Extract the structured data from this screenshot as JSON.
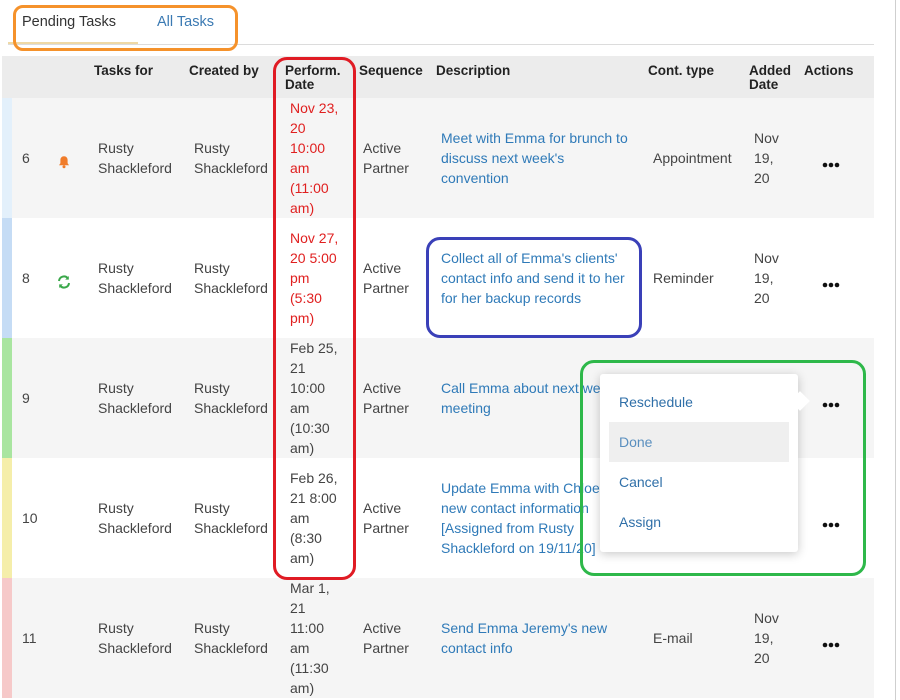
{
  "tabs": {
    "pending": "Pending Tasks",
    "all": "All Tasks"
  },
  "headers": {
    "tasks_for": "Tasks for",
    "created_by": "Created by",
    "perform_date_1": "Perform.",
    "perform_date_2": "Date",
    "sequence": "Sequence",
    "description": "Description",
    "cont_type": "Cont. type",
    "added_date_1": "Added",
    "added_date_2": "Date",
    "actions": "Actions"
  },
  "rows": [
    {
      "id": "6",
      "icon": "bell-icon",
      "tasks_for": [
        "Rusty",
        "Shackleford"
      ],
      "created_by": [
        "Rusty",
        "Shackleford"
      ],
      "perform_date": [
        "Nov 23,",
        "20",
        "10:00",
        "am",
        "(11:00",
        "am)"
      ],
      "overdue": true,
      "sequence": [
        "Active",
        "Partner"
      ],
      "description": [
        "Meet with Emma for brunch to",
        "discuss next week's",
        "convention"
      ],
      "cont_type": "Appointment",
      "added_date": [
        "Nov",
        "19,",
        "20"
      ]
    },
    {
      "id": "8",
      "icon": "recurring-icon",
      "tasks_for": [
        "Rusty",
        "Shackleford"
      ],
      "created_by": [
        "Rusty",
        "Shackleford"
      ],
      "perform_date": [
        "Nov 27,",
        "20 5:00",
        "pm",
        "(5:30",
        "pm)"
      ],
      "overdue": true,
      "sequence": [
        "Active",
        "Partner"
      ],
      "description": [
        "Collect all of Emma's clients'",
        "contact info and send it to her",
        "for her backup records"
      ],
      "cont_type": "Reminder",
      "added_date": [
        "Nov",
        "19,",
        "20"
      ]
    },
    {
      "id": "9",
      "icon": "",
      "tasks_for": [
        "Rusty",
        "Shackleford"
      ],
      "created_by": [
        "Rusty",
        "Shackleford"
      ],
      "perform_date": [
        "Feb 25,",
        "21",
        "10:00",
        "am",
        "(10:30",
        "am)"
      ],
      "overdue": false,
      "sequence": [
        "Active",
        "Partner"
      ],
      "description": [
        "Call Emma about next we",
        "meeting"
      ],
      "cont_type": "",
      "added_date": []
    },
    {
      "id": "10",
      "icon": "",
      "tasks_for": [
        "Rusty",
        "Shackleford"
      ],
      "created_by": [
        "Rusty",
        "Shackleford"
      ],
      "perform_date": [
        "Feb 26,",
        "21 8:00",
        "am",
        "(8:30",
        "am)"
      ],
      "overdue": false,
      "sequence": [
        "Active",
        "Partner"
      ],
      "description": [
        "Update Emma with Chloe",
        "new contact information",
        "[Assigned from Rusty",
        "Shackleford on 19/11/20]"
      ],
      "cont_type": "",
      "added_date": []
    },
    {
      "id": "11",
      "icon": "",
      "tasks_for": [
        "Rusty",
        "Shackleford"
      ],
      "created_by": [
        "Rusty",
        "Shackleford"
      ],
      "perform_date": [
        "Mar 1,",
        "21",
        "11:00",
        "am",
        "(11:30",
        "am)"
      ],
      "overdue": false,
      "sequence": [
        "Active",
        "Partner"
      ],
      "description": [
        "Send Emma Jeremy's new",
        "contact info"
      ],
      "cont_type": "E-mail",
      "added_date": [
        "Nov",
        "19,",
        "20"
      ]
    }
  ],
  "menu": {
    "items": [
      "Reschedule",
      "Done",
      "Cancel",
      "Assign"
    ],
    "highlighted": "Done"
  },
  "colors": {
    "stripes": [
      "#e3f0fb",
      "#c5dcf5",
      "#a9e5a0",
      "#f5eeaa",
      "#f6c9c9"
    ],
    "overdue": "#e02020",
    "link": "#2f7ab8",
    "bell": "#f07c2a",
    "recurring": "#3aa84a",
    "annotation_orange": "#f5922b",
    "annotation_red": "#e01b24",
    "annotation_blue": "#3a40b8",
    "annotation_green": "#2eb84a"
  }
}
